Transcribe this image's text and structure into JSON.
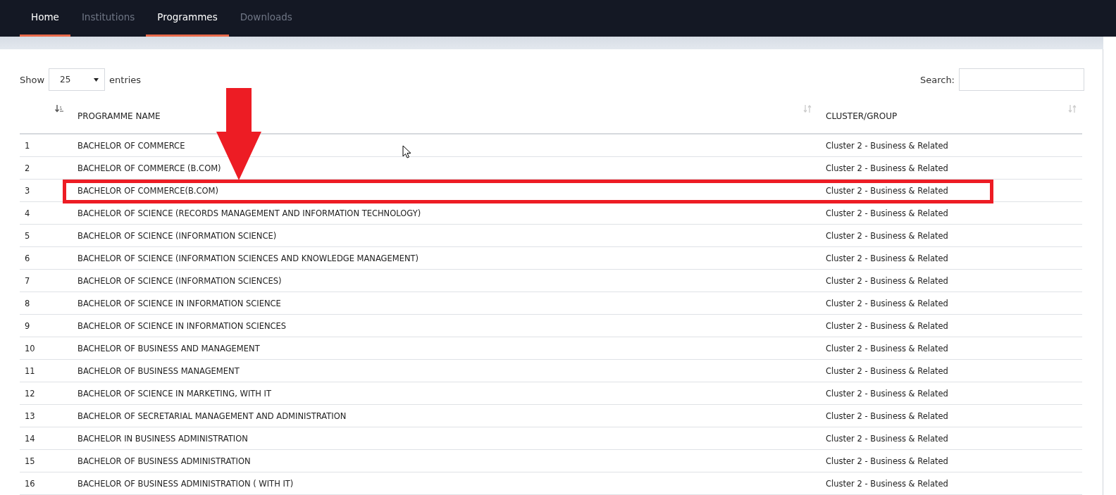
{
  "nav": {
    "tabs": [
      {
        "label": "Home",
        "selected": true
      },
      {
        "label": "Institutions",
        "selected": false
      },
      {
        "label": "Programmes",
        "selected": true
      },
      {
        "label": "Downloads",
        "selected": false
      }
    ]
  },
  "length_menu": {
    "label_before": "Show",
    "value": "25",
    "label_after": "entries"
  },
  "search": {
    "label": "Search:"
  },
  "table": {
    "columns": [
      {
        "sorted_ascending": true
      },
      {
        "label": "PROGRAMME NAME",
        "sorted_ascending": false
      },
      {
        "label": "CLUSTER/GROUP",
        "sorted_ascending": false
      }
    ],
    "rows": [
      {
        "number": "1",
        "programme": "BACHELOR OF COMMERCE",
        "cluster": "Cluster 2 - Business & Related",
        "highlighted": false
      },
      {
        "number": "2",
        "programme": "BACHELOR OF COMMERCE (B.COM)",
        "cluster": "Cluster 2 - Business & Related",
        "highlighted": false
      },
      {
        "number": "3",
        "programme": "BACHELOR OF COMMERCE(B.COM)",
        "cluster": "Cluster 2 - Business & Related",
        "highlighted": true
      },
      {
        "number": "4",
        "programme": "BACHELOR OF SCIENCE (RECORDS MANAGEMENT AND INFORMATION TECHNOLOGY)",
        "cluster": "Cluster 2 - Business & Related",
        "highlighted": false
      },
      {
        "number": "5",
        "programme": "BACHELOR OF SCIENCE (INFORMATION SCIENCE)",
        "cluster": "Cluster 2 - Business & Related",
        "highlighted": false
      },
      {
        "number": "6",
        "programme": "BACHELOR OF SCIENCE (INFORMATION SCIENCES AND KNOWLEDGE MANAGEMENT)",
        "cluster": "Cluster 2 - Business & Related",
        "highlighted": false
      },
      {
        "number": "7",
        "programme": "BACHELOR OF SCIENCE (INFORMATION SCIENCES)",
        "cluster": "Cluster 2 - Business & Related",
        "highlighted": false
      },
      {
        "number": "8",
        "programme": "BACHELOR OF SCIENCE IN INFORMATION SCIENCE",
        "cluster": "Cluster 2 - Business & Related",
        "highlighted": false
      },
      {
        "number": "9",
        "programme": "BACHELOR OF SCIENCE IN INFORMATION SCIENCES",
        "cluster": "Cluster 2 - Business & Related",
        "highlighted": false
      },
      {
        "number": "10",
        "programme": "BACHELOR OF BUSINESS AND MANAGEMENT",
        "cluster": "Cluster 2 - Business & Related",
        "highlighted": false
      },
      {
        "number": "11",
        "programme": "BACHELOR OF BUSINESS MANAGEMENT",
        "cluster": "Cluster 2 - Business & Related",
        "highlighted": false
      },
      {
        "number": "12",
        "programme": "BACHELOR OF SCIENCE IN MARKETING, WITH IT",
        "cluster": "Cluster 2 - Business & Related",
        "highlighted": false
      },
      {
        "number": "13",
        "programme": "BACHELOR OF SECRETARIAL MANAGEMENT AND ADMINISTRATION",
        "cluster": "Cluster 2 - Business & Related",
        "highlighted": false
      },
      {
        "number": "14",
        "programme": "BACHELOR IN BUSINESS ADMINISTRATION",
        "cluster": "Cluster 2 - Business & Related",
        "highlighted": false
      },
      {
        "number": "15",
        "programme": "BACHELOR OF BUSINESS ADMINISTRATION",
        "cluster": "Cluster 2 - Business & Related",
        "highlighted": false
      },
      {
        "number": "16",
        "programme": "BACHELOR OF BUSINESS ADMINISTRATION ( WITH IT)",
        "cluster": "Cluster 2 - Business & Related",
        "highlighted": false
      }
    ]
  }
}
